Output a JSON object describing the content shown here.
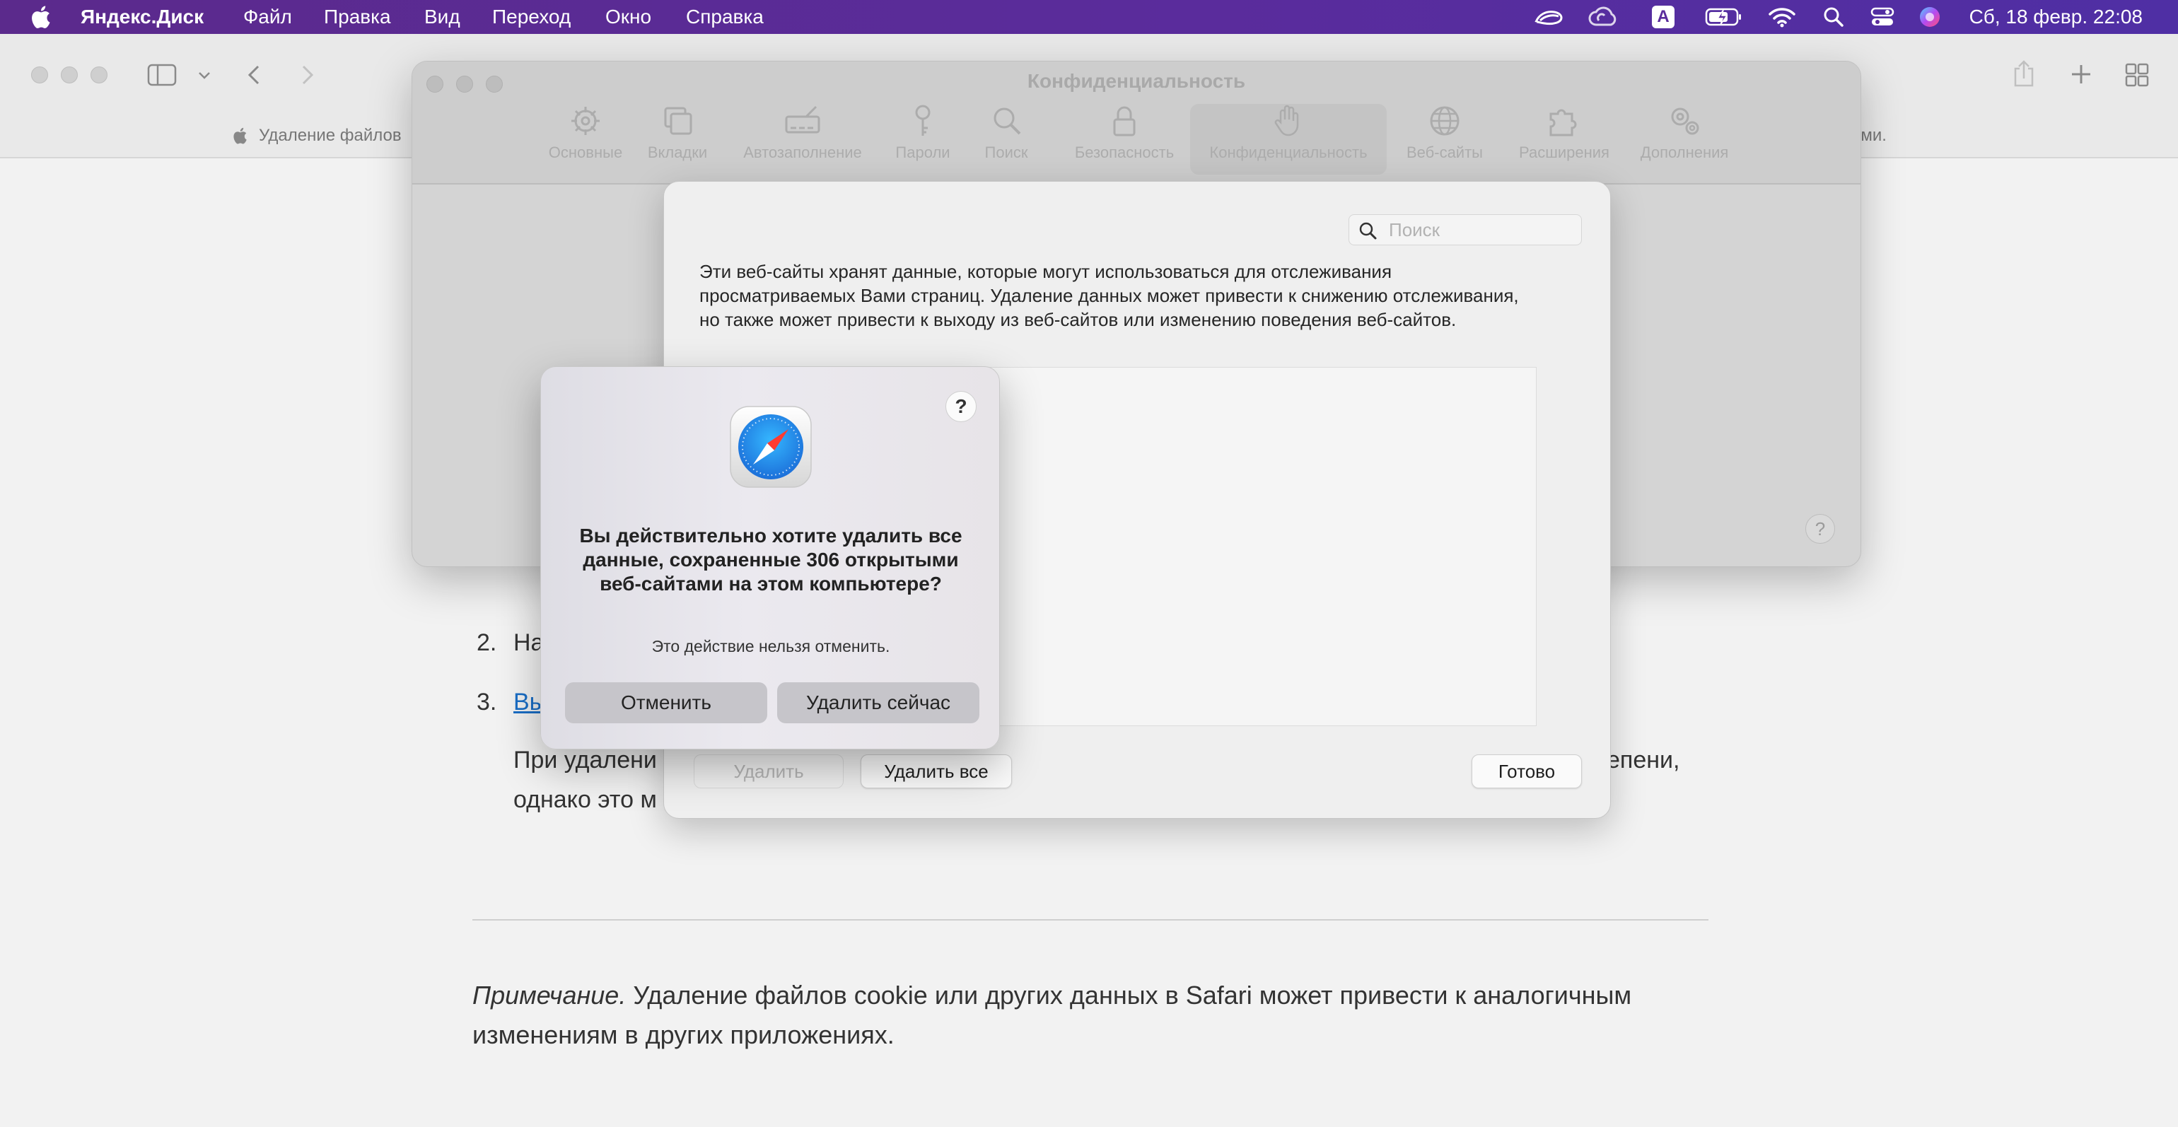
{
  "menubar": {
    "app_name": "Яндекс.Диск",
    "items": [
      "Файл",
      "Правка",
      "Вид",
      "Переход",
      "Окно",
      "Справка"
    ],
    "clock": "Сб, 18 февр. 22:08",
    "status_icons": [
      "yandex-disk-icon",
      "creative-cloud-icon",
      "input-source-icon",
      "battery-icon",
      "wifi-icon",
      "spotlight-icon",
      "control-center-icon",
      "siri-icon"
    ],
    "input_source_label": "A"
  },
  "browser": {
    "tab_left_text": "Удаление файлов",
    "tab_right_text": "ами."
  },
  "page": {
    "item2": {
      "num": "2.",
      "text": "На"
    },
    "item3": {
      "num": "3.",
      "link_text": "Вы",
      "tail": "."
    },
    "para_line1_start": "При удалени",
    "para_line1_end": "епени,",
    "para_line2": "однако это м",
    "note_label": "Примечание.",
    "note_text": " Удаление файлов cookie или других данных в Safari может привести к аналогичным изменениям в других приложениях."
  },
  "preferences": {
    "title": "Конфиденциальность",
    "tabs": [
      {
        "label": "Основные",
        "icon": "gear-icon"
      },
      {
        "label": "Вкладки",
        "icon": "tabs-icon"
      },
      {
        "label": "Автозаполнение",
        "icon": "autofill-icon"
      },
      {
        "label": "Пароли",
        "icon": "key-icon"
      },
      {
        "label": "Поиск",
        "icon": "search-icon"
      },
      {
        "label": "Безопасность",
        "icon": "lock-icon"
      },
      {
        "label": "Конфиденциальность",
        "icon": "hand-icon"
      },
      {
        "label": "Веб-сайты",
        "icon": "globe-icon"
      },
      {
        "label": "Расширения",
        "icon": "puzzle-icon"
      },
      {
        "label": "Дополнения",
        "icon": "gears-icon"
      }
    ],
    "active_tab": "Конфиденциальность",
    "help_label": "?"
  },
  "website_data": {
    "search_placeholder": "Поиск",
    "description": "Эти веб-сайты хранят данные, которые могут использоваться для отслеживания просматриваемых Вами страниц. Удаление данных может привести к снижению отслеживания, но также может привести к выходу из веб-сайтов или изменению поведения веб-сайтов.",
    "remove_label": "Удалить",
    "remove_all_label": "Удалить все",
    "done_label": "Готово"
  },
  "alert": {
    "help_label": "?",
    "title": "Вы действительно хотите удалить все данные, сохраненные 306 открытыми веб-сайтами на этом компьютере?",
    "message": "Это действие нельзя отменить.",
    "cancel_label": "Отменить",
    "confirm_label": "Удалить сейчас"
  },
  "colors": {
    "menubar": "#5a2c9c",
    "link": "#1a6ec6",
    "alert_button": "#c6c5ca"
  }
}
